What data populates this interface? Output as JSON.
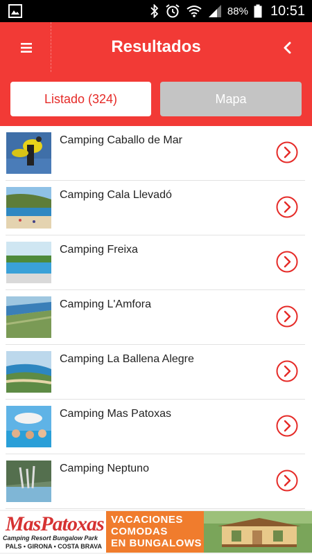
{
  "status_bar": {
    "battery": "88%",
    "time": "10:51",
    "icons": [
      "gallery-icon",
      "bluetooth-icon",
      "alarm-icon",
      "wifi-icon",
      "signal-icon",
      "battery-icon"
    ]
  },
  "header": {
    "title": "Resultados",
    "menu_icon": "menu-icon",
    "back_icon": "back-chevron-icon",
    "color": "#f23a36"
  },
  "tabs": [
    {
      "label": "Listado (324)",
      "active": true
    },
    {
      "label": "Mapa",
      "active": false
    }
  ],
  "results": [
    {
      "name": "Camping Caballo de Mar"
    },
    {
      "name": "Camping Cala Llevadó"
    },
    {
      "name": "Camping Freixa"
    },
    {
      "name": "Camping L'Amfora"
    },
    {
      "name": "Camping La Ballena Alegre"
    },
    {
      "name": "Camping Mas Patoxas"
    },
    {
      "name": "Camping Neptuno"
    }
  ],
  "ad": {
    "logo": "MasPatoxas",
    "logo_sub1": "Camping Resort Bungalow Park",
    "logo_sub2": "PALS • GIRONA • COSTA BRAVA",
    "line1": "VACACIONES",
    "line2": "COMODAS",
    "line3": "EN BUNGALOWS"
  },
  "colors": {
    "accent": "#f23a36",
    "tab_inactive": "#c4c4c4",
    "ad_orange": "#f07c2d"
  }
}
